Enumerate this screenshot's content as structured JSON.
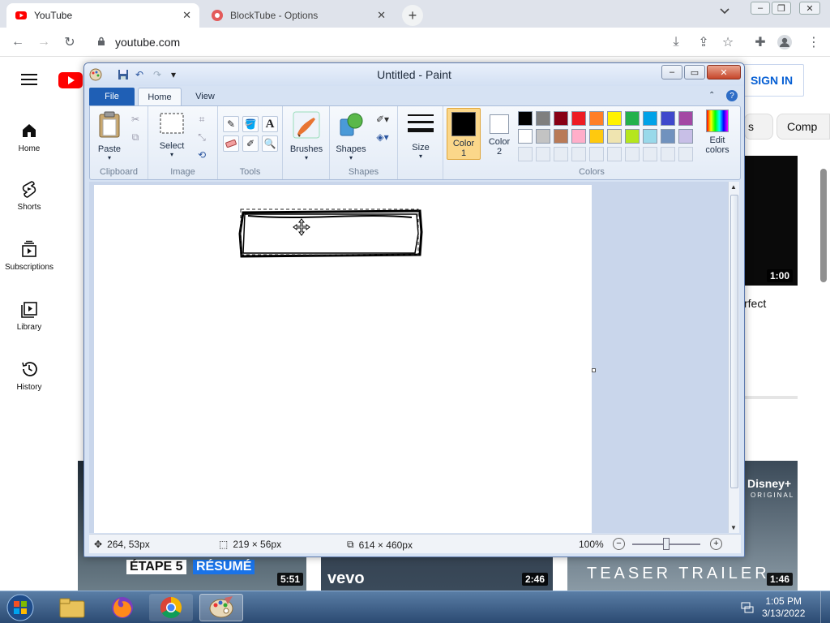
{
  "browser": {
    "tabs": [
      {
        "title": "YouTube",
        "active": true
      },
      {
        "title": "BlockTube - Options",
        "active": false
      }
    ],
    "url": "youtube.com"
  },
  "youtube": {
    "sidebar": [
      {
        "label": "Home",
        "icon": "home-icon"
      },
      {
        "label": "Shorts",
        "icon": "shorts-icon"
      },
      {
        "label": "Subscriptions",
        "icon": "subscriptions-icon"
      },
      {
        "label": "Library",
        "icon": "library-icon"
      },
      {
        "label": "History",
        "icon": "history-icon"
      }
    ],
    "signin_label": "SIGN IN",
    "chips": [
      "s",
      "Comp"
    ],
    "partial_title": "rfect",
    "durations": [
      "1:00",
      "5:51",
      "2:46",
      "1:46"
    ],
    "thumb_texts": {
      "etape": "ÉTAPE 5",
      "resume": "RÉSUMÉ",
      "vevo": "vevo",
      "teaser": "TEASER TRAILER",
      "disney": "Disney+",
      "original": "ORIGINAL"
    }
  },
  "paint": {
    "title": "Untitled - Paint",
    "ribbon_tabs": [
      "File",
      "Home",
      "View"
    ],
    "groups": {
      "clipboard": "Clipboard",
      "image": "Image",
      "tools": "Tools",
      "shapes": "Shapes",
      "colors": "Colors"
    },
    "buttons": {
      "paste": "Paste",
      "select": "Select",
      "brushes": "Brushes",
      "shapes": "Shapes",
      "size": "Size",
      "color1_line1": "Color",
      "color1_line2": "1",
      "color2_line1": "Color",
      "color2_line2": "2",
      "edit_colors_line1": "Edit",
      "edit_colors_line2": "colors"
    },
    "palette_row1": [
      "#000000",
      "#7f7f7f",
      "#880015",
      "#ed1c24",
      "#ff7f27",
      "#fff200",
      "#22b14c",
      "#00a2e8",
      "#3f48cc",
      "#a349a4"
    ],
    "palette_row2": [
      "#ffffff",
      "#c3c3c3",
      "#b97a57",
      "#ffaec9",
      "#ffc90e",
      "#efe4b0",
      "#b5e61d",
      "#99d9ea",
      "#7092be",
      "#c8bfe7"
    ],
    "status": {
      "cursor_pos": "264, 53px",
      "selection_size": "219 × 56px",
      "canvas_size": "614 × 460px",
      "zoom": "100%"
    }
  },
  "taskbar": {
    "time": "1:05 PM",
    "date": "3/13/2022"
  }
}
